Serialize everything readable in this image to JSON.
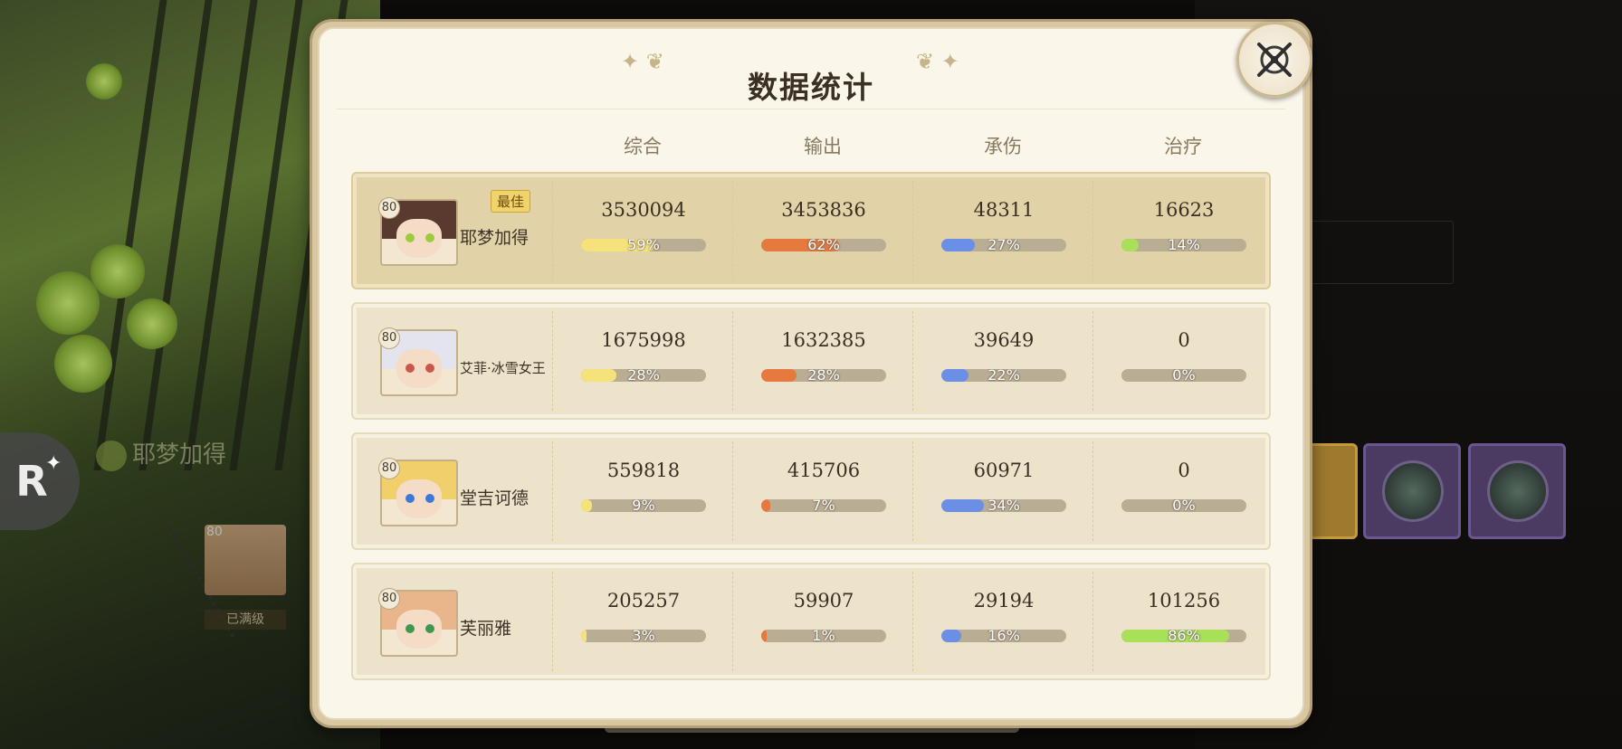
{
  "title": "数据统计",
  "columns": [
    "综合",
    "输出",
    "承伤",
    "治疗"
  ],
  "best_label": "最佳",
  "colors": {
    "综合": "#f6e27a",
    "输出": "#e6793d",
    "承伤": "#6b8ee6",
    "治疗": "#a9e05a"
  },
  "rows": [
    {
      "level": "80",
      "name": "耶梦加得",
      "best": true,
      "stats": [
        {
          "value": "3530094",
          "pct": "59%",
          "fraction": 0.59
        },
        {
          "value": "3453836",
          "pct": "62%",
          "fraction": 0.62
        },
        {
          "value": "48311",
          "pct": "27%",
          "fraction": 0.27
        },
        {
          "value": "16623",
          "pct": "14%",
          "fraction": 0.14
        }
      ]
    },
    {
      "level": "80",
      "name": "艾菲·冰雪女王",
      "best": false,
      "stats": [
        {
          "value": "1675998",
          "pct": "28%",
          "fraction": 0.28
        },
        {
          "value": "1632385",
          "pct": "28%",
          "fraction": 0.28
        },
        {
          "value": "39649",
          "pct": "22%",
          "fraction": 0.22
        },
        {
          "value": "0",
          "pct": "0%",
          "fraction": 0
        }
      ]
    },
    {
      "level": "80",
      "name": "堂吉诃德",
      "best": false,
      "stats": [
        {
          "value": "559818",
          "pct": "9%",
          "fraction": 0.09
        },
        {
          "value": "415706",
          "pct": "7%",
          "fraction": 0.07
        },
        {
          "value": "60971",
          "pct": "34%",
          "fraction": 0.34
        },
        {
          "value": "0",
          "pct": "0%",
          "fraction": 0
        }
      ]
    },
    {
      "level": "80",
      "name": "芙丽雅",
      "best": false,
      "stats": [
        {
          "value": "205257",
          "pct": "3%",
          "fraction": 0.03
        },
        {
          "value": "59907",
          "pct": "1%",
          "fraction": 0.01
        },
        {
          "value": "29194",
          "pct": "16%",
          "fraction": 0.16
        },
        {
          "value": "101256",
          "pct": "86%",
          "fraction": 0.86
        }
      ]
    }
  ],
  "background": {
    "badge": "R",
    "ghost_name": "耶梦加得",
    "avatar_level": "80",
    "avatar_status": "已满级"
  },
  "icons": {
    "close": "close-x-icon",
    "ornament_left": "ornament-left-icon",
    "ornament_right": "ornament-right-icon"
  }
}
